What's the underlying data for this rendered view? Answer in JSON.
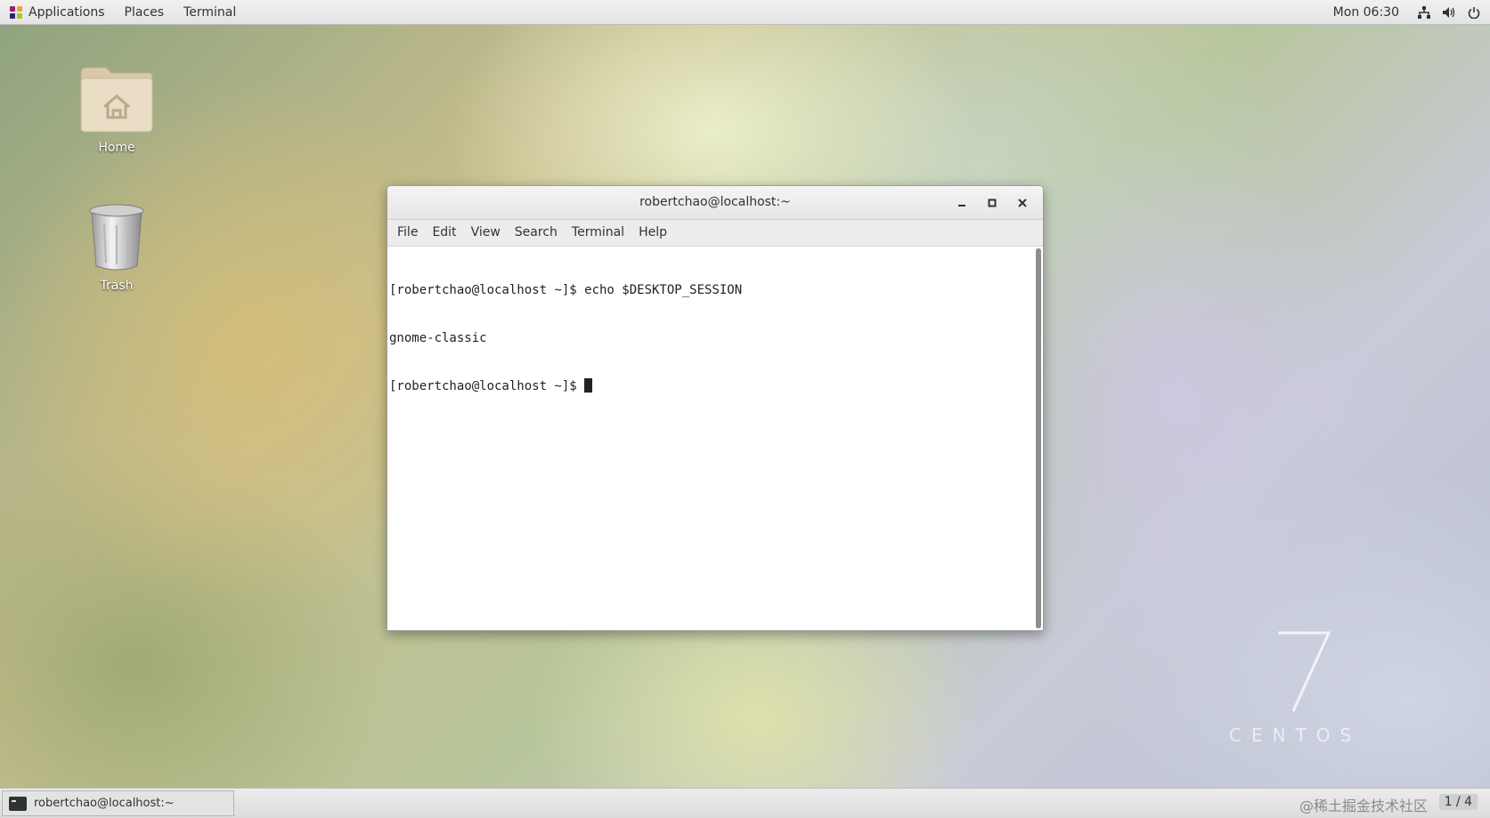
{
  "top_panel": {
    "applications": "Applications",
    "places": "Places",
    "terminal": "Terminal",
    "clock": "Mon 06:30",
    "tray_icons": [
      "network-icon",
      "volume-icon",
      "power-icon"
    ]
  },
  "desktop": {
    "icons": [
      {
        "label": "Home",
        "icon": "home-folder-icon"
      },
      {
        "label": "Trash",
        "icon": "trash-icon"
      }
    ],
    "branding": {
      "number": "7",
      "name": "CENTOS"
    }
  },
  "window": {
    "title": "robertchao@localhost:~",
    "menu": [
      "File",
      "Edit",
      "View",
      "Search",
      "Terminal",
      "Help"
    ],
    "lines": [
      "[robertchao@localhost ~]$ echo $DESKTOP_SESSION",
      "gnome-classic",
      "[robertchao@localhost ~]$ "
    ]
  },
  "bottom_panel": {
    "task_label": "robertchao@localhost:~",
    "watermark": "@稀土掘金技术社区",
    "workspace": "1 / 4"
  },
  "colors": {
    "panel_bg": "#e6e6e6",
    "text": "#2e3436",
    "terminal_bg": "#ffffff"
  }
}
